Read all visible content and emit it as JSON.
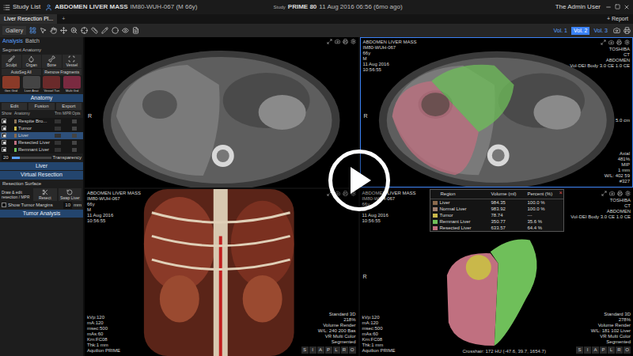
{
  "top_bar": {
    "study_list": "Study List",
    "title": "ABDOMEN LIVER MASS",
    "patient": "IM80-WUH-067 (M 66y)",
    "study_label": "Study",
    "study_name": "PRIME 80",
    "study_date": "11 Aug 2016 06:56 (6mo ago)",
    "user": "The Admin User"
  },
  "tabs": [
    {
      "label": "Liver Resection Pl...",
      "selected": true
    },
    {
      "label": "+",
      "selected": false
    }
  ],
  "report": "+ Report",
  "toolbar": {
    "gallery": "Gallery",
    "volumes": [
      {
        "label": "Vol. 1",
        "selected": false
      },
      {
        "label": "Vol. 2",
        "selected": true
      },
      {
        "label": "Vol. 3",
        "selected": false
      }
    ]
  },
  "left_panel": {
    "mode_tabs": [
      {
        "label": "Analysis",
        "selected": true
      },
      {
        "label": "Batch",
        "selected": false
      }
    ],
    "segment_title": "Segment Anatomy",
    "tools": [
      "Sculpt",
      "Organ",
      "Bone",
      "Vessel"
    ],
    "actions": [
      "AutoSeg All",
      "Remove Fragments"
    ],
    "presets": [
      "Gen Grid",
      "Liver Anat",
      "Vessel Tun",
      "Multi Grd"
    ],
    "anatomy_title": "Anatomy",
    "anatomy_buttons": [
      "Edit",
      "Fusion",
      "Export"
    ],
    "anatomy_columns": [
      "Show",
      "Anatomy",
      "Trm MPR",
      "Opts"
    ],
    "anatomy_rows": [
      {
        "name": "Respite Bro...",
        "shown": true,
        "selected": false,
        "color": "#8b7355"
      },
      {
        "name": "Tumor",
        "shown": true,
        "selected": false,
        "color": "#c9b84a"
      },
      {
        "name": "Liver",
        "shown": true,
        "selected": true,
        "color": "#8b6a4d"
      },
      {
        "name": "Resected Liver",
        "shown": true,
        "selected": false,
        "color": "#c07080"
      },
      {
        "name": "Remnant Liver",
        "shown": true,
        "selected": false,
        "color": "#6fbf5a"
      }
    ],
    "transparency": {
      "value": "20",
      "label": "Transparency",
      "level": 0.2
    },
    "liver_title": "Liver",
    "virtual_resection": "Virtual Resection",
    "resection_surface": "Resection Surface",
    "draw_edit": "Draw & edit resection / MPR",
    "resection_buttons": [
      "Resect",
      "Swap Liver"
    ],
    "tumor_margin": {
      "label": "Show Tumor Margins",
      "value": "10",
      "unit": "mm",
      "checked": false
    },
    "tumor_analysis": "Tumor Analysis"
  },
  "viewports": [
    {
      "kind": "ct",
      "marker": "R",
      "top_left": [],
      "top_right": [],
      "bottom_left": [],
      "bottom_right": [],
      "orientation": []
    },
    {
      "kind": "ct-seg",
      "marker": "R",
      "scale": "5.0 cm",
      "top_left": [
        "ABDOMEN LIVER MASS",
        "IM80-WUH-067",
        "66y",
        "M",
        "11 Aug 2016",
        "10:56:55"
      ],
      "top_right": [
        "TOSHIBA",
        "CT",
        "ABDOMEN",
        "Vol-DEI Body 3.0 CE 1.0 CE"
      ],
      "bottom_left": [],
      "bottom_right": [
        "Axial",
        "481%",
        "MIP",
        "1 mm",
        "W/L: 402 59",
        "#327"
      ],
      "orientation": []
    },
    {
      "kind": "vr",
      "marker": "",
      "top_left": [
        "ABDOMEN LIVER MASS",
        "IM80-WUH-067",
        "66y",
        "M",
        "11 Aug 2016",
        "10:56:55"
      ],
      "top_right": [],
      "bottom_left": [
        "kVp:120",
        "mA:120",
        "msec:500",
        "mAs:60",
        "Krn:FC08",
        "Thk:1 mm",
        "Aquilion PRIME"
      ],
      "bottom_right": [
        "Standard 3D",
        "218%",
        "Volume Render",
        "W/L: 240 200 Bas",
        "VR Multi Color",
        "Segmented"
      ],
      "orientation": [
        "S",
        "I",
        "A",
        "P",
        "L",
        "R",
        "O"
      ]
    },
    {
      "kind": "vr-seg",
      "marker": "R",
      "top_left": [
        "ABDOMEN LIVER MASS",
        "IM80-WUH-067",
        "66y",
        "M",
        "11 Aug 2016",
        "10:56:55"
      ],
      "top_right": [
        "TOSHIBA",
        "CT",
        "ABDOMEN",
        "Vol-DEI Body 3.0 CE 1.0 CE"
      ],
      "bottom_left": [
        "kVp:120",
        "mA:120",
        "msec:500",
        "mAs:60",
        "Krn:FC08",
        "Thk:1 mm",
        "Aquilion PRIME"
      ],
      "bottom_right": [
        "Standard 3D",
        "278%",
        "Volume Render",
        "W/L: 181 102 Liver",
        "VR Multi Color",
        "Segmented"
      ],
      "orientation": [
        "S",
        "I",
        "A",
        "P",
        "L",
        "R",
        "O"
      ]
    }
  ],
  "volume_table": {
    "close": "×",
    "columns": [
      "Region",
      "Volume (ml)",
      "Percent (%)"
    ],
    "rows": [
      {
        "region": "Liver",
        "volume": "984.35",
        "percent": "100.0 %",
        "color": "#8b6a4d"
      },
      {
        "region": "Normal Liver",
        "volume": "983.92",
        "percent": "100.0 %",
        "color": "#a08070"
      },
      {
        "region": "Tumor",
        "volume": "78.74",
        "percent": "---",
        "color": "#c9b84a"
      },
      {
        "region": "Remnant Liver",
        "volume": "350.77",
        "percent": "35.6 %",
        "color": "#6fbf5a"
      },
      {
        "region": "Resected Liver",
        "volume": "633.57",
        "percent": "64.4 %",
        "color": "#c07080"
      }
    ]
  },
  "status_bar": "Crosshair: 172 HU (-47.6, 39.7, 1654.7)"
}
